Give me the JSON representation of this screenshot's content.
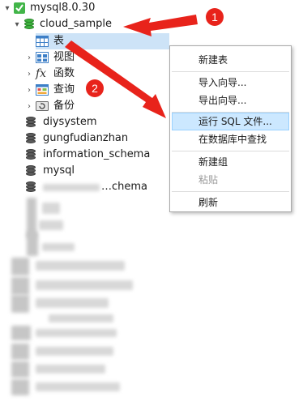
{
  "tree": {
    "connection": "mysql8.0.30",
    "active_db": "cloud_sample",
    "children": [
      {
        "label": "表",
        "icon": "table-icon"
      },
      {
        "label": "视图",
        "icon": "view-icon"
      },
      {
        "label": "函数",
        "icon": "function-icon"
      },
      {
        "label": "查询",
        "icon": "query-icon"
      },
      {
        "label": "备份",
        "icon": "backup-icon"
      }
    ],
    "databases": [
      "diysystem",
      "gungfudianzhan",
      "information_schema",
      "mysql",
      "…chema"
    ]
  },
  "context_menu": {
    "items": [
      "新建表",
      "导入向导...",
      "导出向导...",
      "运行 SQL 文件...",
      "在数据库中查找",
      "新建组",
      "粘贴",
      "刷新"
    ],
    "highlighted": "运行 SQL 文件...",
    "disabled": "粘贴"
  },
  "annotations": {
    "badge_1": "1",
    "badge_2": "2",
    "arrow_color": "#e8231b"
  }
}
